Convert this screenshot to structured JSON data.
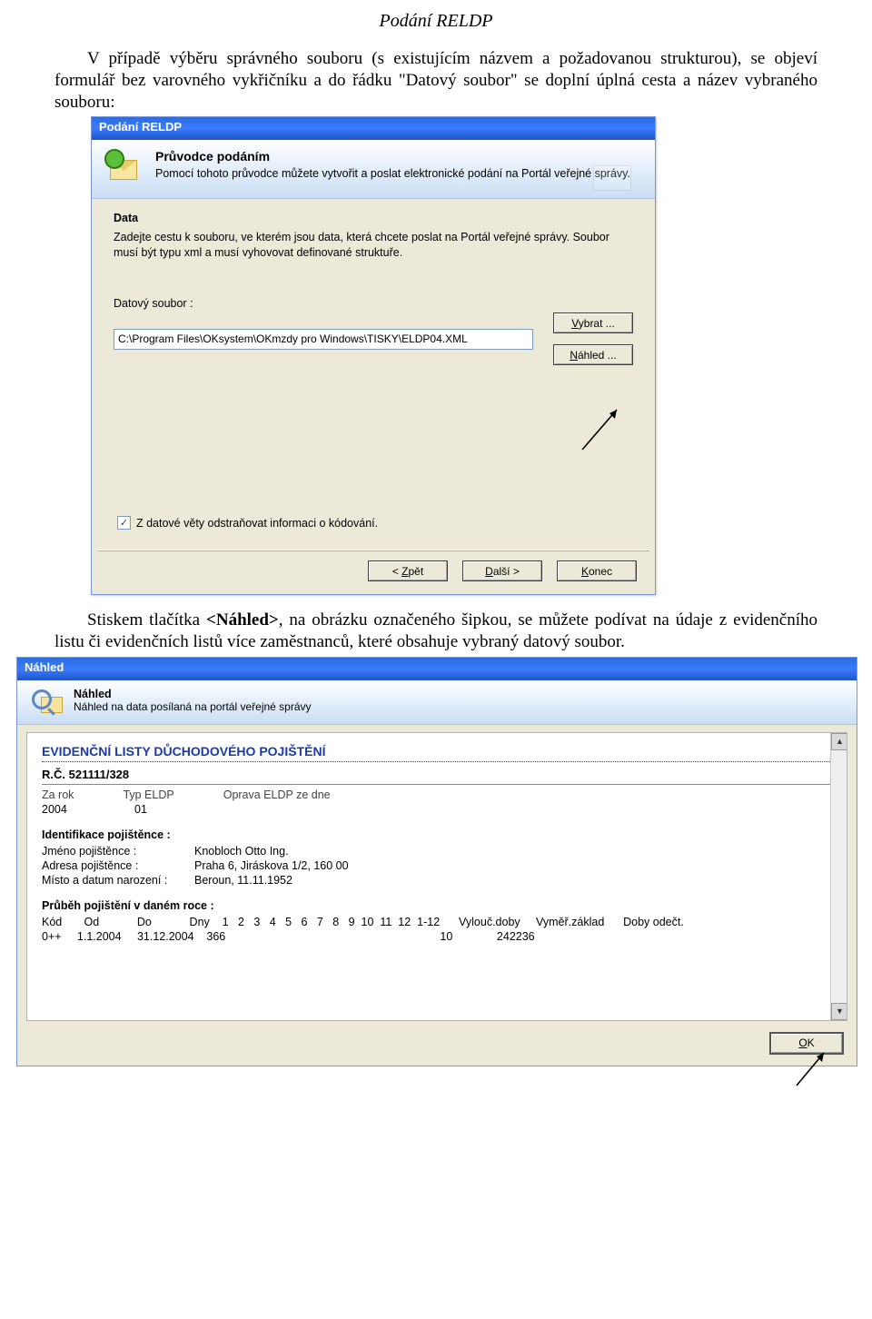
{
  "page_header": "Podání RELDP",
  "intro_text": "V případě výběru správného souboru (s existujícím názvem a požadovanou strukturou), se objeví formulář bez varovného vykřičníku a do řádku \"Datový soubor\" se doplní úplná cesta a název vybraného souboru:",
  "dialog1": {
    "title": "Podání RELDP",
    "wizard_title": "Průvodce podáním",
    "wizard_sub": "Pomocí tohoto průvodce můžete vytvořit a poslat elektronické podání na Portál veřejné správy.",
    "data_heading": "Data",
    "data_text": "Zadejte cestu k souboru, ve kterém jsou data, která chcete poslat na Portál veřejné správy. Soubor musí být typu xml a musí vyhovovat definované struktuře.",
    "field_label": "Datový soubor :",
    "input_value": "C:\\Program Files\\OKsystem\\OKmzdy pro Windows\\TISKY\\ELDP04.XML",
    "btn_vybrat": "Vybrat ...",
    "btn_nahled": "Náhled ...",
    "checkbox_label": "Z datové věty odstraňovat informaci o kódování.",
    "btn_back": "< Zpět",
    "btn_next": "Další >",
    "btn_end": "Konec"
  },
  "mid_text_pre": "Stiskem tlačítka ",
  "mid_text_bold": "<Náhled>",
  "mid_text_post": ", na obrázku označeného šipkou, se můžete podívat na údaje z evidenčního listu či evidenčních listů více zaměstnanců, které obsahuje vybraný datový soubor.",
  "dialog2": {
    "title": "Náhled",
    "header_title": "Náhled",
    "header_sub": "Náhled na data posílaná na portál veřejné správy",
    "blue_heading": "EVIDENČNÍ LISTY DŮCHODOVÉHO POJIŠTĚNÍ",
    "rc_label": "R.Č. 521111/328",
    "row1_labels": {
      "zarok": "Za rok",
      "typ": "Typ ELDP",
      "oprava": "Oprava ELDP ze dne"
    },
    "row1_values": {
      "zarok": "2004",
      "typ": "01",
      "oprava": ""
    },
    "ident_title": "Identifikace pojištěnce :",
    "ident": {
      "jmeno_l": "Jméno pojištěnce :",
      "jmeno_v": "Knobloch Otto Ing.",
      "adresa_l": "Adresa pojištěnce :",
      "adresa_v": "Praha 6, Jiráskova 1/2, 160 00",
      "misto_l": "Místo a datum narození :",
      "misto_v": "Beroun, 11.11.1952"
    },
    "prubeh_title": "Průběh pojištění v daném roce :",
    "prubeh_head": "Kód       Od            Do            Dny    1   2   3   4   5   6   7   8   9  10  11  12  1-12      Vylouč.doby     Vyměř.základ      Doby odečt.",
    "prubeh_vals": "0++     1.1.2004     31.12.2004    366                                                                    10              242236",
    "btn_ok": "OK"
  }
}
